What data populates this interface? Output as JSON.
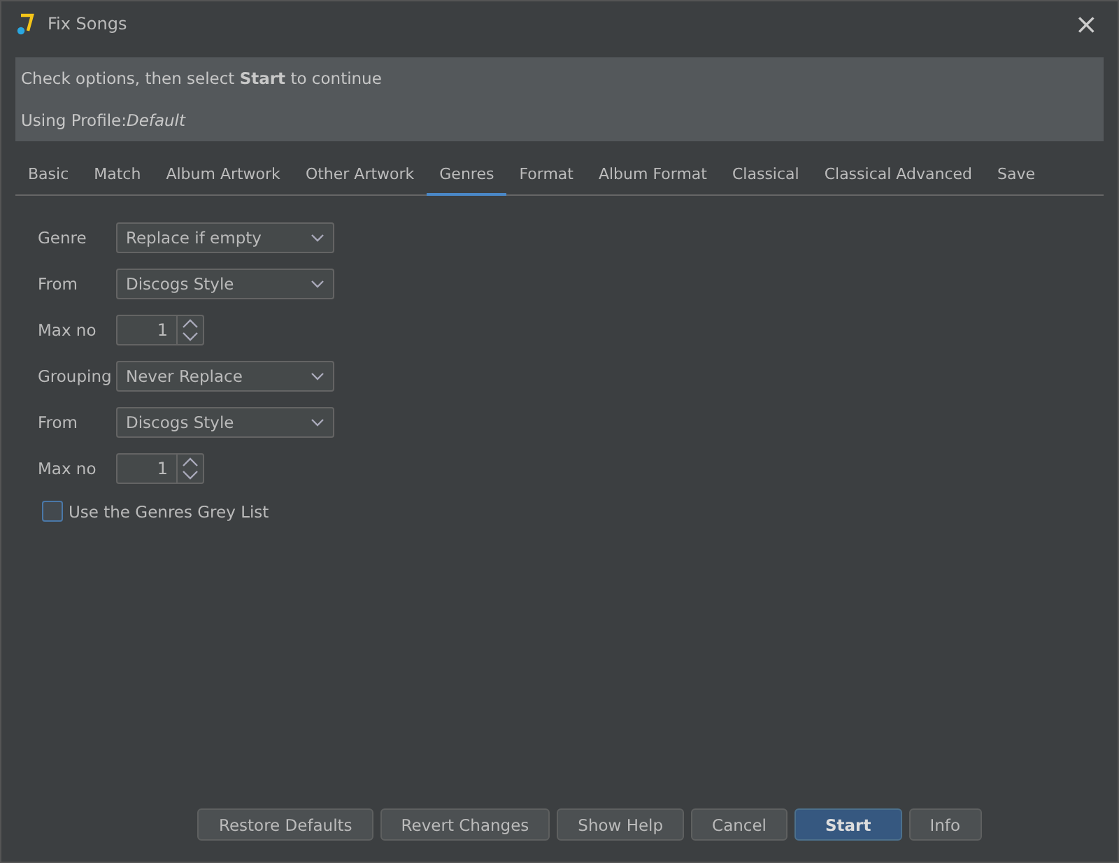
{
  "window": {
    "title": "Fix Songs",
    "close": "×"
  },
  "info": {
    "message": "Check options, then select **Start** to continue",
    "profile": "Using Profile:*Default*"
  },
  "tabs": [
    {
      "label": "Basic",
      "selected": false
    },
    {
      "label": "Match",
      "selected": false
    },
    {
      "label": "Album Artwork",
      "selected": false
    },
    {
      "label": "Other Artwork",
      "selected": false
    },
    {
      "label": "Genres",
      "selected": true
    },
    {
      "label": "Format",
      "selected": false
    },
    {
      "label": "Album Format",
      "selected": false
    },
    {
      "label": "Classical",
      "selected": false
    },
    {
      "label": "Classical Advanced",
      "selected": false
    },
    {
      "label": "Save",
      "selected": false
    }
  ],
  "rows": [
    {
      "kind": "select",
      "label": "Genre",
      "value": "Replace if empty"
    },
    {
      "kind": "select",
      "label": "From",
      "value": "Discogs Style"
    },
    {
      "kind": "spinner",
      "label": "Max no",
      "value": "1"
    },
    {
      "kind": "select",
      "label": "Grouping",
      "value": "Never Replace"
    },
    {
      "kind": "select",
      "label": "From",
      "value": "Discogs Style"
    },
    {
      "kind": "spinner",
      "label": "Max no",
      "value": "1"
    }
  ],
  "checkbox": {
    "label": "Use the Genres Grey List",
    "checked": false
  },
  "buttons": [
    {
      "label": "Restore Defaults",
      "kind": "normal"
    },
    {
      "label": "Revert Changes",
      "kind": "normal"
    },
    {
      "label": "Show Help",
      "kind": "normal"
    },
    {
      "label": "Cancel",
      "kind": "normal"
    },
    {
      "label": "Start",
      "kind": "primary"
    },
    {
      "label": "Info",
      "kind": "normal"
    }
  ]
}
